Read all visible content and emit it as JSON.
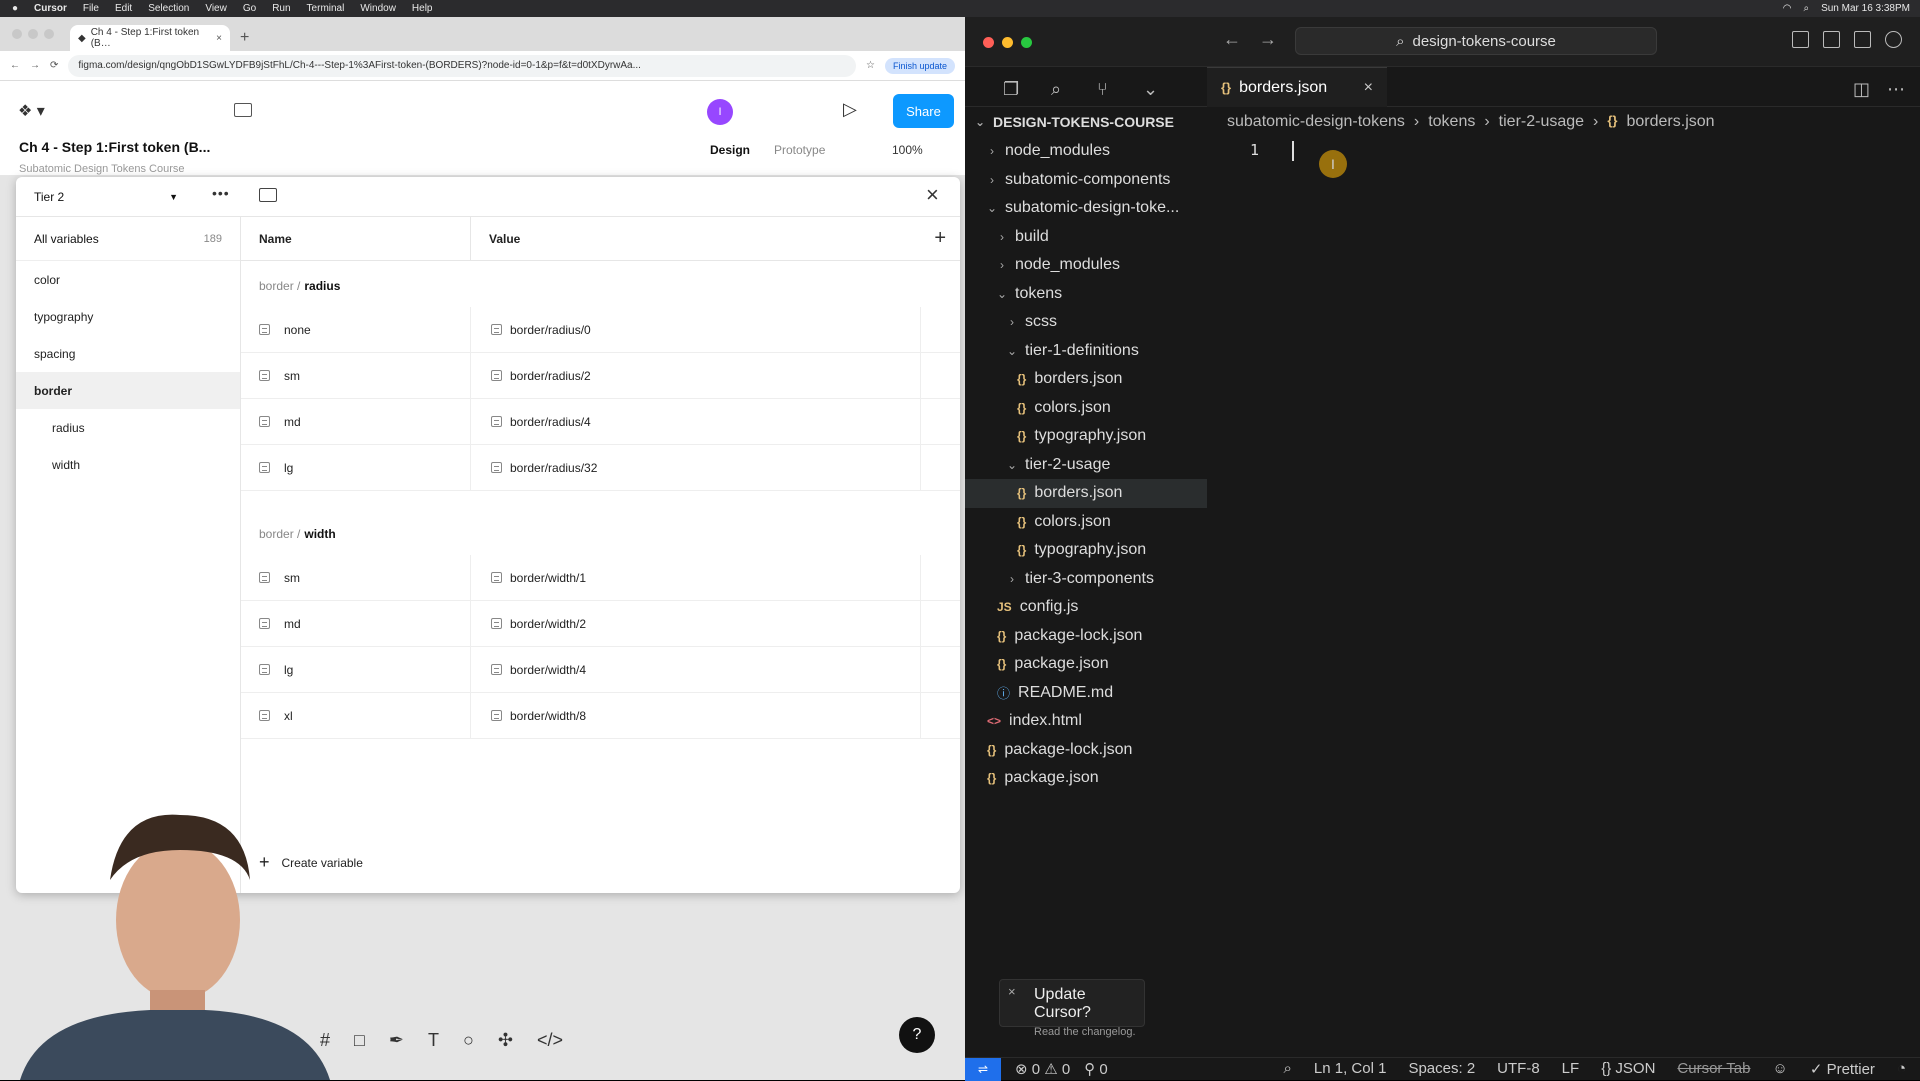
{
  "menubar": {
    "app": "Cursor",
    "items": [
      "File",
      "Edit",
      "Selection",
      "View",
      "Go",
      "Run",
      "Terminal",
      "Window",
      "Help"
    ],
    "clock": "Sun Mar 16  3:38PM"
  },
  "browser": {
    "tab_title": "Ch 4 - Step 1:First token (B…",
    "url": "figma.com/design/qngObD1SGwLYDFB9jStFhL/Ch-4---Step-1%3AFirst-token-(BORDERS)?node-id=0-1&p=f&t=d0tXDyrwAa...",
    "finish_update": "Finish update"
  },
  "figma": {
    "file_title": "Ch 4 - Step 1:First token (B...",
    "file_subtitle": "Subatomic Design Tokens Course",
    "avatar_letter": "I",
    "share_label": "Share",
    "mode_design": "Design",
    "mode_prototype": "Prototype",
    "zoom": "100%"
  },
  "variables": {
    "collection": "Tier 2",
    "all_label": "All variables",
    "all_count": "189",
    "groups": [
      "color",
      "typography",
      "spacing",
      "border",
      "radius",
      "width"
    ],
    "col_name": "Name",
    "col_value": "Value",
    "radius_prefix": "border /",
    "radius_title": "radius",
    "radius_rows": [
      {
        "name": "none",
        "value": "border/radius/0"
      },
      {
        "name": "sm",
        "value": "border/radius/2"
      },
      {
        "name": "md",
        "value": "border/radius/4"
      },
      {
        "name": "lg",
        "value": "border/radius/32"
      }
    ],
    "width_prefix": "border /",
    "width_title": "width",
    "width_rows": [
      {
        "name": "sm",
        "value": "border/width/1"
      },
      {
        "name": "md",
        "value": "border/width/2"
      },
      {
        "name": "lg",
        "value": "border/width/4"
      },
      {
        "name": "xl",
        "value": "border/width/8"
      }
    ],
    "create_label": "Create variable"
  },
  "editor": {
    "command_center": "design-tokens-course",
    "active_tab": "borders.json",
    "explorer_root": "DESIGN-TOKENS-COURSE",
    "tree": [
      "node_modules",
      "subatomic-components",
      "subatomic-design-toke...",
      "build",
      "node_modules",
      "tokens",
      "scss",
      "tier-1-definitions",
      "borders.json",
      "colors.json",
      "typography.json",
      "tier-2-usage",
      "borders.json",
      "colors.json",
      "typography.json",
      "tier-3-components",
      "config.js",
      "package-lock.json",
      "package.json",
      "README.md",
      "index.html",
      "package-lock.json",
      "package.json"
    ],
    "breadcrumbs": [
      "subatomic-design-tokens",
      "tokens",
      "tier-2-usage",
      "borders.json"
    ],
    "line_number": "1",
    "notice_title": "Update Cursor?",
    "notice_sub": "Read the changelog.",
    "status": {
      "errors": "0",
      "warnings": "0",
      "ports": "0",
      "position": "Ln 1, Col 1",
      "spaces": "Spaces: 2",
      "encoding": "UTF-8",
      "eol": "LF",
      "language": "JSON",
      "cursor_tab": "Cursor Tab",
      "prettier": "Prettier"
    }
  }
}
